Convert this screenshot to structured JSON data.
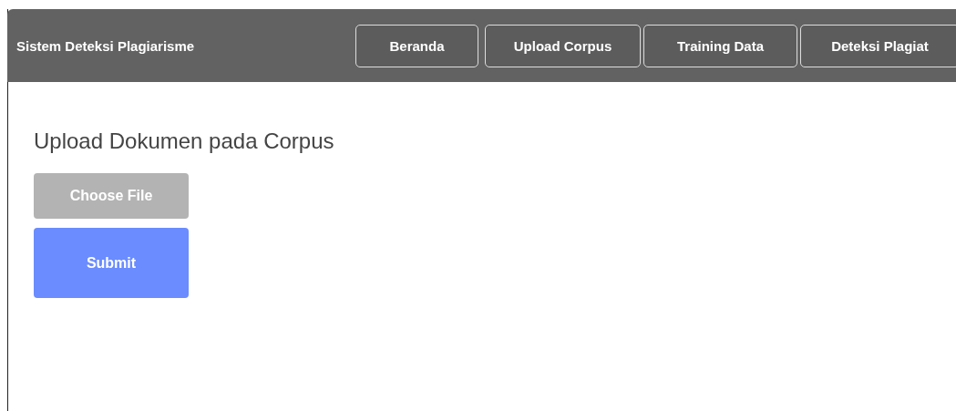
{
  "navbar": {
    "brand": "Sistem Deteksi Plagiarisme",
    "items": [
      {
        "label": "Beranda"
      },
      {
        "label": "Upload Corpus"
      },
      {
        "label": "Training Data"
      },
      {
        "label": "Deteksi Plagiat"
      }
    ]
  },
  "page": {
    "heading": "Upload Dokumen pada Corpus",
    "file_button": "Choose File",
    "submit_button": "Submit"
  }
}
